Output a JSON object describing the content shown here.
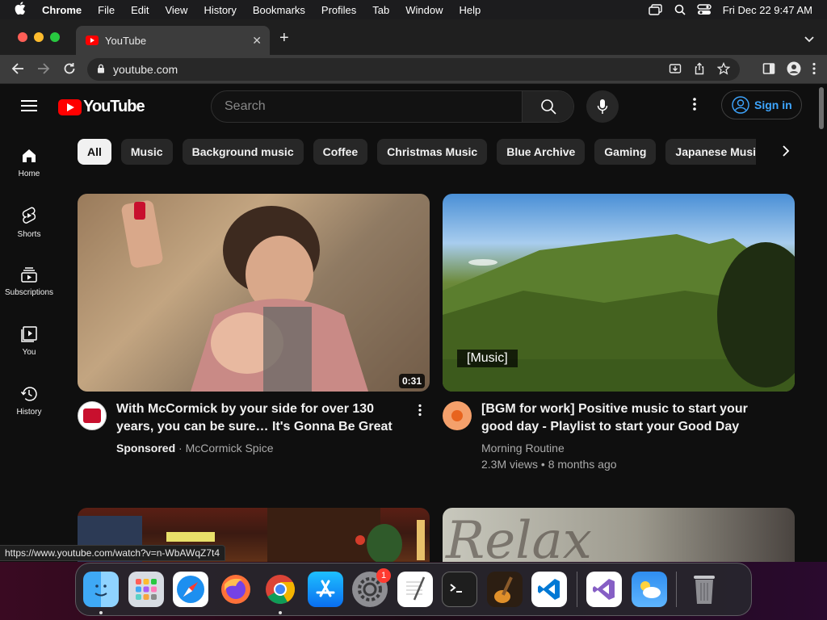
{
  "menubar": {
    "app": "Chrome",
    "items": [
      "File",
      "Edit",
      "View",
      "History",
      "Bookmarks",
      "Profiles",
      "Tab",
      "Window",
      "Help"
    ],
    "clock": "Fri Dec 22  9:47 AM"
  },
  "browser": {
    "tab_title": "YouTube",
    "url": "youtube.com",
    "status_url": "https://www.youtube.com/watch?v=n-WbAWqZ7t4"
  },
  "youtube": {
    "logo_text": "YouTube",
    "search_placeholder": "Search",
    "signin_label": "Sign in",
    "chips": [
      "All",
      "Music",
      "Background music",
      "Coffee",
      "Christmas Music",
      "Blue Archive",
      "Gaming",
      "Japanese Music"
    ],
    "active_chip": "All",
    "guide": [
      {
        "label": "Home",
        "icon": "home-icon"
      },
      {
        "label": "Shorts",
        "icon": "shorts-icon"
      },
      {
        "label": "Subscriptions",
        "icon": "subscriptions-icon"
      },
      {
        "label": "You",
        "icon": "you-icon"
      },
      {
        "label": "History",
        "icon": "history-icon"
      }
    ],
    "videos": [
      {
        "title": "With McCormick by your side for over 130 years, you can be sure… It's Gonna Be Great",
        "duration": "0:31",
        "sponsored": "Sponsored",
        "channel": "McCormick Spice"
      },
      {
        "title": "[BGM for work] Positive music to start your good day - Playlist to start your Good Day",
        "caption": "[Music]",
        "channel": "Morning Routine",
        "stats": "2.3M views • 8 months ago"
      }
    ],
    "thumb4_overlay": "Relax"
  },
  "dock": {
    "apps": [
      "Finder",
      "Launchpad",
      "Safari",
      "Firefox",
      "Chrome",
      "App Store",
      "System Settings",
      "TextEdit",
      "Terminal",
      "GarageBand",
      "Visual Studio Code",
      "Visual Studio",
      "Weather",
      "Trash"
    ],
    "settings_badge": "1"
  },
  "colors": {
    "accent_red": "#ff0000",
    "link_blue": "#3ea6ff",
    "background": "#0f0f0f"
  }
}
